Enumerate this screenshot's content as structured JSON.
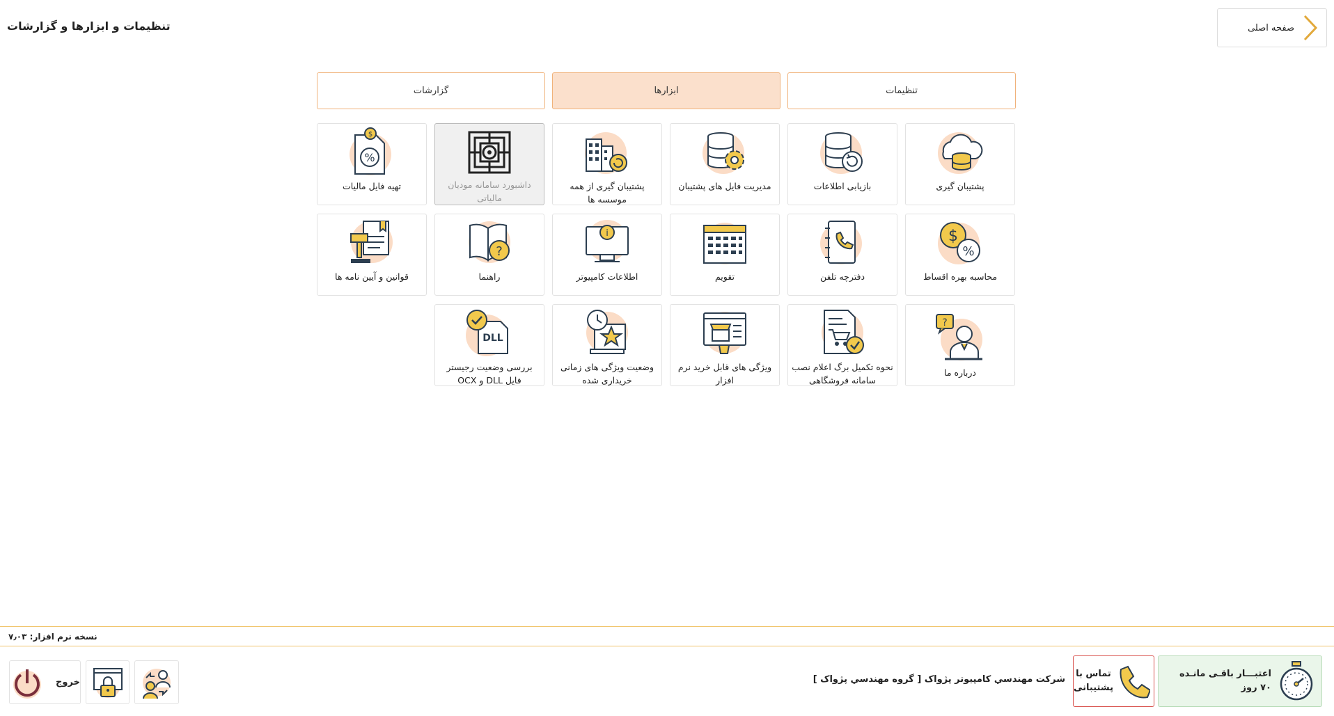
{
  "header": {
    "home_label": "صفحه اصلی",
    "title": "تنظیمات و ابزارها و گزارشات"
  },
  "tabs": [
    {
      "label": "تنظیمات",
      "active": false
    },
    {
      "label": "ابزارها",
      "active": true
    },
    {
      "label": "گزارشات",
      "active": false
    }
  ],
  "tiles": [
    {
      "label": "پشتیبان گیری",
      "icon": "cloud-database-icon"
    },
    {
      "label": "بازیابی اطلاعات",
      "icon": "database-restore-icon"
    },
    {
      "label": "مدیریت فایل های پشتیبان",
      "icon": "database-gear-icon"
    },
    {
      "label": "پشتیبان گیری از همه موسسه ها",
      "icon": "building-backup-icon"
    },
    {
      "label": "داشبورد سامانه مودیان مالیاتی",
      "icon": "tax-portal-emblem-icon",
      "disabled": true
    },
    {
      "label": "تهیه فایل مالیات",
      "icon": "tax-percent-file-icon"
    },
    {
      "label": "محاسبه بهره اقساط",
      "icon": "dollar-percent-icon"
    },
    {
      "label": "دفترچه تلفن",
      "icon": "phonebook-icon"
    },
    {
      "label": "تقویم",
      "icon": "calendar-icon"
    },
    {
      "label": "اطلاعات کامپیوتر",
      "icon": "computer-info-icon"
    },
    {
      "label": "راهنما",
      "icon": "help-book-icon"
    },
    {
      "label": "قوانین و آیین نامه ها",
      "icon": "gavel-rules-icon"
    },
    {
      "label": "درباره ما",
      "icon": "about-user-icon"
    },
    {
      "label": "نحوه تکمیل برگ اعلام نصب سامانه فروشگاهی",
      "icon": "cart-document-icon"
    },
    {
      "label": "ویژگی های قابل خرید نرم افزار",
      "icon": "store-features-icon"
    },
    {
      "label": "وضعیت ویژگی های زمانی خریداری شده",
      "icon": "clock-star-icon"
    },
    {
      "label": "بررسی وضعیت رجیستر فایل DLL و OCX",
      "icon": "dll-check-icon"
    }
  ],
  "footer": {
    "version": "نسخه نرم افزار: ۷٫۰۳",
    "credit_line1": "اعتبـــار باقـی مانـده",
    "credit_line2": "۷۰ روز",
    "support_line1": "تماس با",
    "support_line2": "پشتیبانی",
    "company": "شرکت مهندسي کامپيوتر پژواک [ گروه مهندسي پژواک ]",
    "exit_label": "خروج"
  },
  "colors": {
    "accent": "#f0b27a",
    "active_tab": "#fbe0cc",
    "icon_blob": "#fbdcc6",
    "icon_yellow": "#f2c94c",
    "icon_navy": "#2c3e50"
  }
}
